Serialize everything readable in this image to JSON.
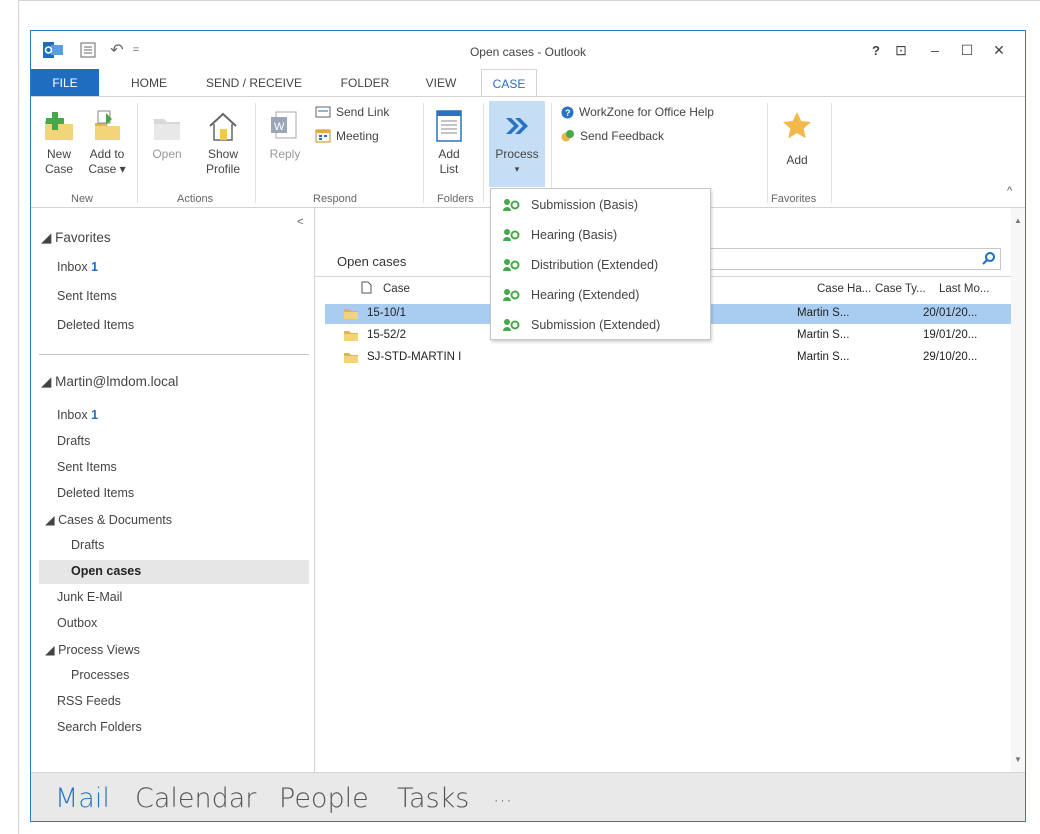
{
  "window": {
    "title": "Open cases - Outlook",
    "controls": [
      "?",
      "⊡",
      "–",
      "☐",
      "✕"
    ]
  },
  "quick_access": {
    "undo": "↶",
    "dropdown": "="
  },
  "tabs": [
    "FILE",
    "HOME",
    "SEND / RECEIVE",
    "FOLDER",
    "VIEW",
    "CASE"
  ],
  "ribbon": {
    "new_group": {
      "label": "New",
      "new_case": [
        "New",
        "Case"
      ],
      "add_to_case": [
        "Add to",
        "Case ▾"
      ]
    },
    "actions_group": {
      "label": "Actions",
      "open": "Open",
      "show_profile": [
        "Show",
        "Profile"
      ]
    },
    "respond_group": {
      "label": "Respond",
      "reply": "Reply",
      "send_link": "Send Link",
      "meeting": "Meeting"
    },
    "folders_group": {
      "label": "Folders",
      "add_list": [
        "Add",
        "List"
      ]
    },
    "process_group": {
      "process": "Process",
      "arrow": "▾"
    },
    "help_group": {
      "workzone_help": "WorkZone for Office Help",
      "send_feedback": "Send Feedback"
    },
    "favorites_group": {
      "label": "Favorites",
      "add": "Add"
    },
    "collapse": "^"
  },
  "nav": {
    "collapse": "<",
    "favorites": {
      "header": "◢ Favorites",
      "items": [
        {
          "label": "Inbox",
          "count": "1"
        },
        {
          "label": "Sent Items",
          "count": ""
        },
        {
          "label": "Deleted Items",
          "count": ""
        }
      ]
    },
    "account": {
      "header": "◢ Martin@lmdom.local",
      "items": [
        {
          "label": "Inbox",
          "count": "1"
        },
        {
          "label": "Drafts",
          "count": ""
        },
        {
          "label": "Sent Items",
          "count": ""
        },
        {
          "label": "Deleted Items",
          "count": ""
        },
        {
          "label": "◢ Cases & Documents",
          "count": ""
        },
        {
          "label": "Drafts",
          "count": ""
        },
        {
          "label": "Open cases",
          "count": ""
        },
        {
          "label": "Junk E-Mail",
          "count": ""
        },
        {
          "label": "Outbox",
          "count": ""
        },
        {
          "label": "◢ Process Views",
          "count": ""
        },
        {
          "label": "Processes",
          "count": ""
        },
        {
          "label": "RSS Feeds",
          "count": ""
        },
        {
          "label": "Search Folders",
          "count": ""
        }
      ]
    }
  },
  "content": {
    "title": "Open cases",
    "columns": [
      "Case",
      "Case Ha...",
      "Case Ty...",
      "Last Mo..."
    ],
    "rows": [
      {
        "case": "15-10/1",
        "handler": "Martin S...",
        "type": "",
        "modified": "20/01/20...",
        "selected": true
      },
      {
        "case": "15-52/2",
        "handler": "Martin S...",
        "type": "",
        "modified": "19/01/20...",
        "selected": false
      },
      {
        "case": "SJ-STD-MARTIN I",
        "handler": "Martin S...",
        "type": "",
        "modified": "29/10/20...",
        "selected": false
      }
    ]
  },
  "process_menu": [
    "Submission (Basis)",
    "Hearing (Basis)",
    "Distribution (Extended)",
    "Hearing (Extended)",
    "Submission (Extended)"
  ],
  "bottom_nav": [
    "Mail",
    "Calendar",
    "People",
    "Tasks",
    "···"
  ],
  "colors": {
    "accent": "#1f6dc0",
    "selection": "#a9cdf1",
    "nav_selected": "#e6e6e6"
  }
}
